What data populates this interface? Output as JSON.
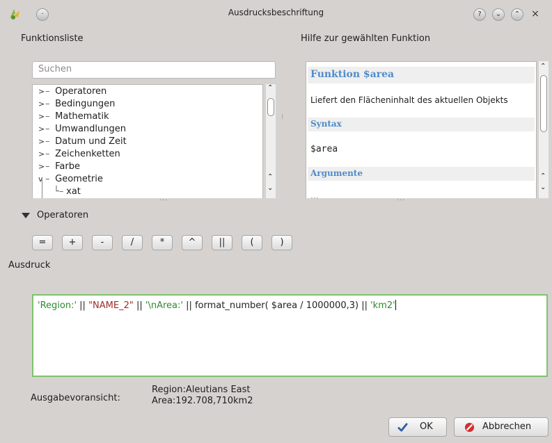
{
  "window": {
    "title": "Ausdrucksbeschriftung",
    "buttons": [
      "?",
      "⌄",
      "⌃",
      "×"
    ]
  },
  "left": {
    "title": "Funktionsliste",
    "search_placeholder": "Suchen",
    "tree_items": [
      {
        "label": "Operatoren",
        "expander": ">"
      },
      {
        "label": "Bedingungen",
        "expander": ">"
      },
      {
        "label": "Mathematik",
        "expander": ">"
      },
      {
        "label": "Umwandlungen",
        "expander": ">"
      },
      {
        "label": "Datum und Zeit",
        "expander": ">"
      },
      {
        "label": "Zeichenketten",
        "expander": ">"
      },
      {
        "label": "Farbe",
        "expander": ">"
      },
      {
        "label": "Geometrie",
        "expander": "v"
      },
      {
        "label": "xat",
        "expander": ""
      }
    ]
  },
  "right": {
    "title": "Hilfe zur gewählten Funktion",
    "heading": "Funktion $area",
    "description": "Liefert den Flächeninhalt des aktuellen Objekts",
    "syntax_label": "Syntax",
    "syntax_value": "$area",
    "args_label": "Argumente",
    "args_partial": "..."
  },
  "operators": {
    "section_label": "Operatoren",
    "buttons": [
      "=",
      "+",
      "-",
      "/",
      "*",
      "^",
      "||",
      "(",
      ")"
    ]
  },
  "expression": {
    "label": "Ausdruck",
    "tokens": [
      {
        "t": "'Region:'",
        "k": "str"
      },
      {
        "t": " || ",
        "k": "op"
      },
      {
        "t": "\"NAME_2\"",
        "k": "field"
      },
      {
        "t": " || ",
        "k": "op"
      },
      {
        "t": "'\\nArea:'",
        "k": "str"
      },
      {
        "t": " || format_number( $area / 1000000,3) || ",
        "k": "op"
      },
      {
        "t": "'km2'",
        "k": "str"
      }
    ]
  },
  "preview": {
    "label": "Ausgabevoransicht:",
    "line1": "Region:Aleutians East",
    "line2": "Area:192.708,710km2"
  },
  "footer": {
    "ok_label": "OK",
    "cancel_label": "Abbrechen"
  },
  "colors": {
    "accent_green": "#7fc26b",
    "help_heading_blue": "#4f8cc9",
    "string_green": "#2f8a2f",
    "field_red": "#a12b2b"
  }
}
